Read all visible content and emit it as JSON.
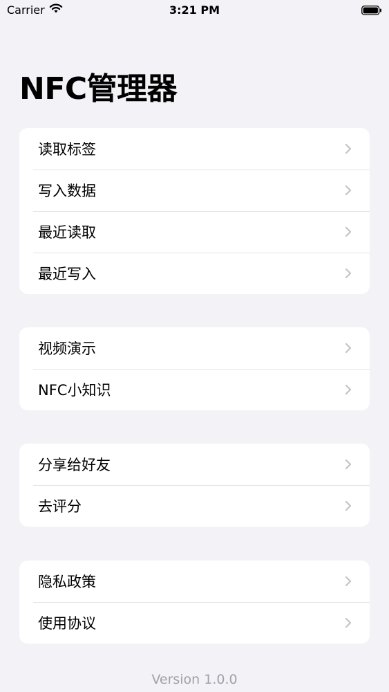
{
  "status_bar": {
    "carrier": "Carrier",
    "time": "3:21 PM"
  },
  "title": "NFC管理器",
  "groups": [
    {
      "items": [
        {
          "label": "读取标签"
        },
        {
          "label": "写入数据"
        },
        {
          "label": "最近读取"
        },
        {
          "label": "最近写入"
        }
      ]
    },
    {
      "items": [
        {
          "label": "视频演示"
        },
        {
          "label": "NFC小知识"
        }
      ]
    },
    {
      "items": [
        {
          "label": "分享给好友"
        },
        {
          "label": "去评分"
        }
      ]
    },
    {
      "items": [
        {
          "label": "隐私政策"
        },
        {
          "label": "使用协议"
        }
      ]
    }
  ],
  "footer": {
    "version": "Version 1.0.0"
  },
  "colors": {
    "background": "#f2f2f7",
    "card": "#ffffff",
    "separator": "#e3e3e8",
    "chevron": "#c4c4c7",
    "secondary_text": "#a0a0a6"
  },
  "icons": {
    "wifi": "wifi-icon",
    "battery": "battery-icon",
    "chevron": "chevron-right-icon"
  }
}
